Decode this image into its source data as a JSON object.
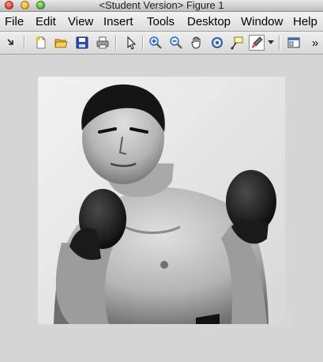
{
  "window": {
    "title": "<Student Version> Figure 1"
  },
  "menu": [
    "File",
    "Edit",
    "View",
    "Insert",
    "Tools",
    "Desktop",
    "Window",
    "Help"
  ],
  "toolbar": {
    "icons": [
      "dock-arrow-icon",
      "new-figure-icon",
      "open-file-icon",
      "save-icon",
      "print-icon",
      "select-arrow-icon",
      "zoom-in-icon",
      "zoom-out-icon",
      "pan-hand-icon",
      "rotate-3d-icon",
      "data-cursor-icon",
      "brush-icon",
      "brush-menu-icon",
      "show-plot-tools-icon",
      "overflow-icon"
    ],
    "overflow_label": "»"
  },
  "figure": {
    "image_subject": "grayscale photograph of a boxer in fighting stance"
  },
  "colors": {
    "figure_background": "#d6d6d6",
    "menubar": "#e6e6e6"
  }
}
